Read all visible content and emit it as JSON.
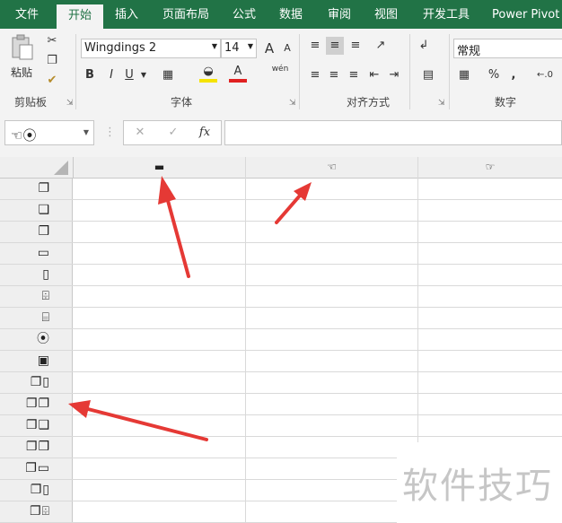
{
  "tabs": [
    "文件",
    "开始",
    "插入",
    "页面布局",
    "公式",
    "数据",
    "审阅",
    "视图",
    "开发工具",
    "Power Pivot"
  ],
  "ribbon": {
    "clipboard": {
      "paste_label": "粘贴",
      "group_label": "剪贴板"
    },
    "font": {
      "font_name": "Wingdings 2",
      "font_size": "14",
      "bold": "B",
      "italic": "I",
      "underline": "U",
      "grow": "A",
      "shrink": "A",
      "phonetic": "wén",
      "group_label": "字体"
    },
    "alignment": {
      "group_label": "对齐方式"
    },
    "number": {
      "format": "常规",
      "percent": "%",
      "comma": ",",
      "group_label": "数字"
    }
  },
  "formula_bar": {
    "name_box": "☜⦿",
    "cancel": "✕",
    "enter": "✓",
    "fx": "fx",
    "formula": ""
  },
  "column_headers": [
    "▬",
    "☜",
    "☞"
  ],
  "row_headers": [
    "❐",
    "❑",
    "❒",
    "▭",
    "▯",
    "⌹",
    "⌸",
    "⦿",
    "▣",
    "❐▯",
    "❐❐",
    "❐❑",
    "❐❒",
    "❐▭",
    "❐▯",
    "❐⌹"
  ],
  "watermark": "软件技巧",
  "colors": {
    "excel_green": "#217346",
    "annotation_arrow": "#e53935"
  }
}
